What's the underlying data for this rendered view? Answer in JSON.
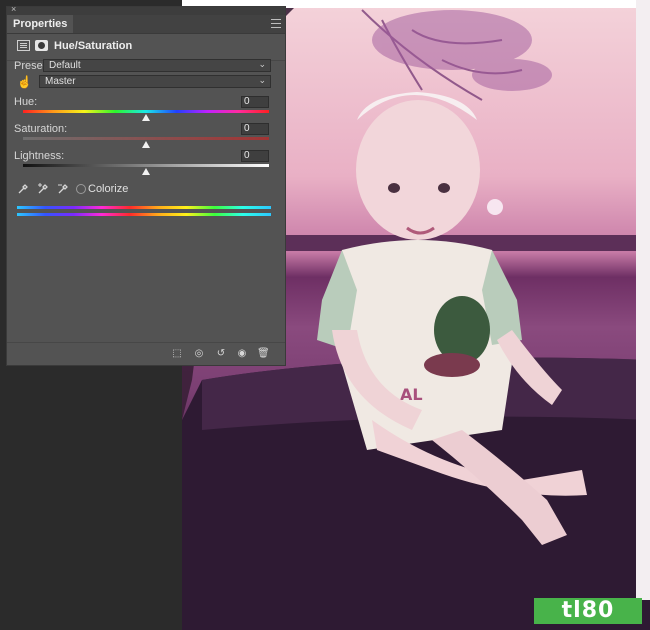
{
  "panel": {
    "close_glyph": "×",
    "tab_title": "Properties",
    "menu_icon": "panel-menu-icon",
    "adjustment_icon": "adjustment-layer-icon",
    "mask_icon": "mask-icon",
    "header_title": "Hue/Saturation",
    "preset_label": "Preset:",
    "preset_value": "Default",
    "channel_value": "Master",
    "hue_label": "Hue:",
    "hue_value": "0",
    "saturation_label": "Saturation:",
    "saturation_value": "0",
    "lightness_label": "Lightness:",
    "lightness_value": "0",
    "colorize_label": "Colorize",
    "colorize_checked": false,
    "hue_level": 0.5,
    "saturation_level": 0.5,
    "lightness_level": 0.5,
    "bottom_icons": [
      "clip-to-layer-icon",
      "view-previous-state-icon",
      "reset-icon",
      "visibility-eye-icon",
      "trash-icon"
    ]
  },
  "colors": {
    "panel_bg": "#535353",
    "photo_sky": "#f4d3da",
    "photo_water": "#7b3f73",
    "logo_bg": "#48b34a"
  },
  "logo": {
    "text": "tl80"
  }
}
